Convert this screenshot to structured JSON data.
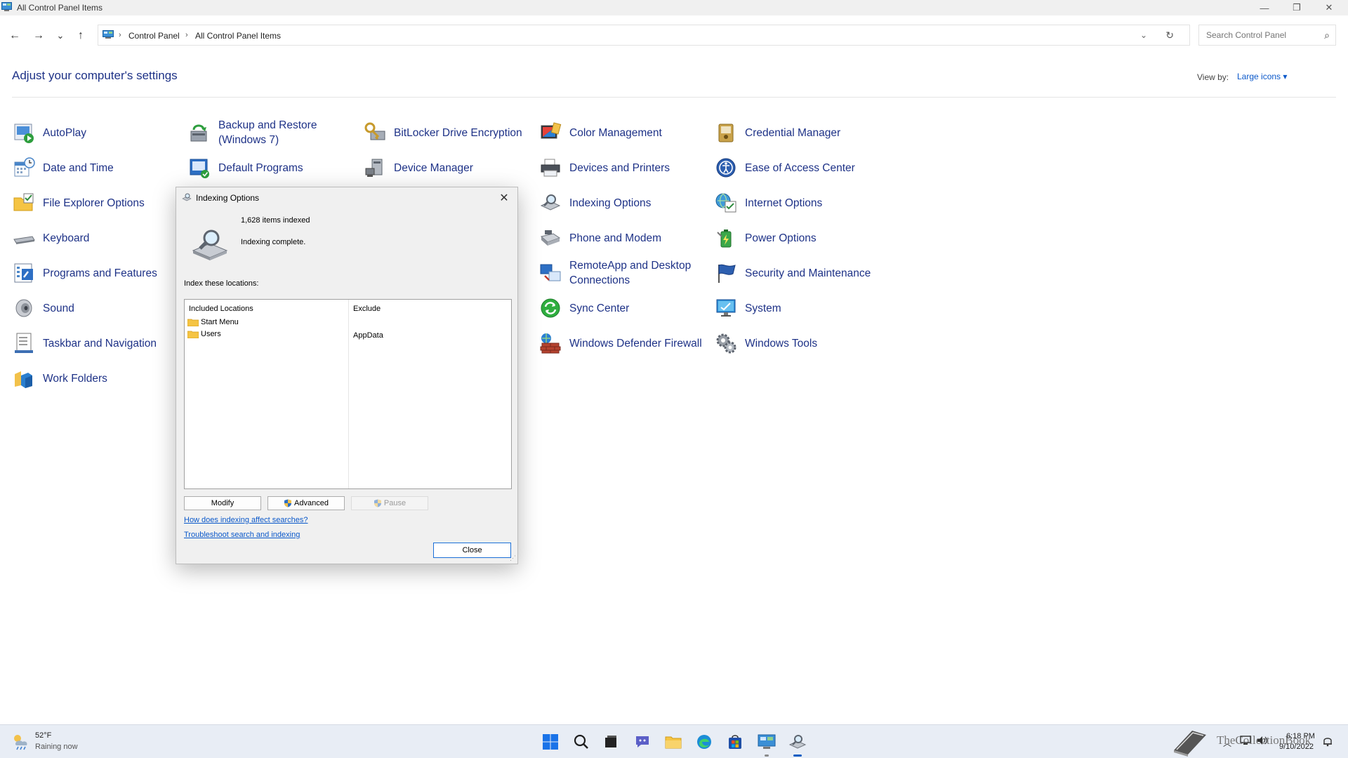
{
  "window": {
    "title": "All Control Panel Items",
    "buttons": {
      "minimize": "—",
      "restore": "❐",
      "close": "✕"
    }
  },
  "nav": {
    "back": "←",
    "forward": "→",
    "recent": "⌄",
    "up": "↑"
  },
  "address": {
    "crumbs": [
      "Control Panel",
      "All Control Panel Items"
    ],
    "separator": "›",
    "dropdown": "⌄",
    "refresh": "↻"
  },
  "search": {
    "placeholder": "Search Control Panel",
    "icon": "⌕"
  },
  "page": {
    "heading": "Adjust your computer's settings",
    "view_by_label": "View by:",
    "view_by_value": "Large icons ▾"
  },
  "items": [
    {
      "label": "AutoPlay",
      "icon": "autoplay-icon"
    },
    {
      "label": "Backup and Restore (Windows 7)",
      "icon": "backup-icon"
    },
    {
      "label": "BitLocker Drive Encryption",
      "icon": "bitlocker-icon"
    },
    {
      "label": "Color Management",
      "icon": "color-management-icon"
    },
    {
      "label": "Credential Manager",
      "icon": "credential-icon"
    },
    {
      "label": "Date and Time",
      "icon": "date-time-icon"
    },
    {
      "label": "Default Programs",
      "icon": "default-programs-icon"
    },
    {
      "label": "Device Manager",
      "icon": "device-manager-icon"
    },
    {
      "label": "Devices and Printers",
      "icon": "printer-icon"
    },
    {
      "label": "Ease of Access Center",
      "icon": "ease-of-access-icon"
    },
    {
      "label": "File Explorer Options",
      "icon": "folder-options-icon"
    },
    {
      "label": "Indexing Options",
      "icon": "indexing-icon"
    },
    {
      "label": "Internet Options",
      "icon": "internet-options-icon"
    },
    {
      "label": "Keyboard",
      "icon": "keyboard-icon"
    },
    {
      "label": "Phone and Modem",
      "icon": "phone-modem-icon"
    },
    {
      "label": "Power Options",
      "icon": "power-icon"
    },
    {
      "label": "Programs and Features",
      "icon": "programs-icon"
    },
    {
      "label": "RemoteApp and Desktop Connections",
      "icon": "remoteapp-icon"
    },
    {
      "label": "Security and Maintenance",
      "icon": "security-flag-icon"
    },
    {
      "label": "Sound",
      "icon": "sound-icon"
    },
    {
      "label": "Sync Center",
      "icon": "sync-icon"
    },
    {
      "label": "System",
      "icon": "system-icon"
    },
    {
      "label": "Taskbar and Navigation",
      "icon": "taskbar-icon"
    },
    {
      "label": "Windows Defender Firewall",
      "icon": "firewall-icon"
    },
    {
      "label": "Windows Tools",
      "icon": "tools-gear-icon"
    },
    {
      "label": "Work Folders",
      "icon": "work-folders-icon"
    }
  ],
  "dialog": {
    "title": "Indexing Options",
    "close_glyph": "✕",
    "items_indexed": "1,628 items indexed",
    "status": "Indexing complete.",
    "locations_label": "Index these locations:",
    "columns": {
      "included": "Included Locations",
      "exclude": "Exclude"
    },
    "included": [
      "Start Menu",
      "Users"
    ],
    "excluded": [
      "AppData"
    ],
    "buttons": {
      "modify": "Modify",
      "advanced": "Advanced",
      "pause": "Pause",
      "close": "Close"
    },
    "links": {
      "how": "How does indexing affect searches?",
      "troubleshoot": "Troubleshoot search and indexing"
    }
  },
  "taskbar": {
    "weather_temp": "52°F",
    "weather_desc": "Raining now",
    "tray_chevron": "︿",
    "clock_time": "6:18 PM",
    "clock_date": "9/10/2022",
    "watermark": "TheCollectionBook"
  },
  "colors": {
    "link": "#1e3287",
    "accent": "#0a5dc2",
    "dialog_bg": "#f0f0f0"
  }
}
